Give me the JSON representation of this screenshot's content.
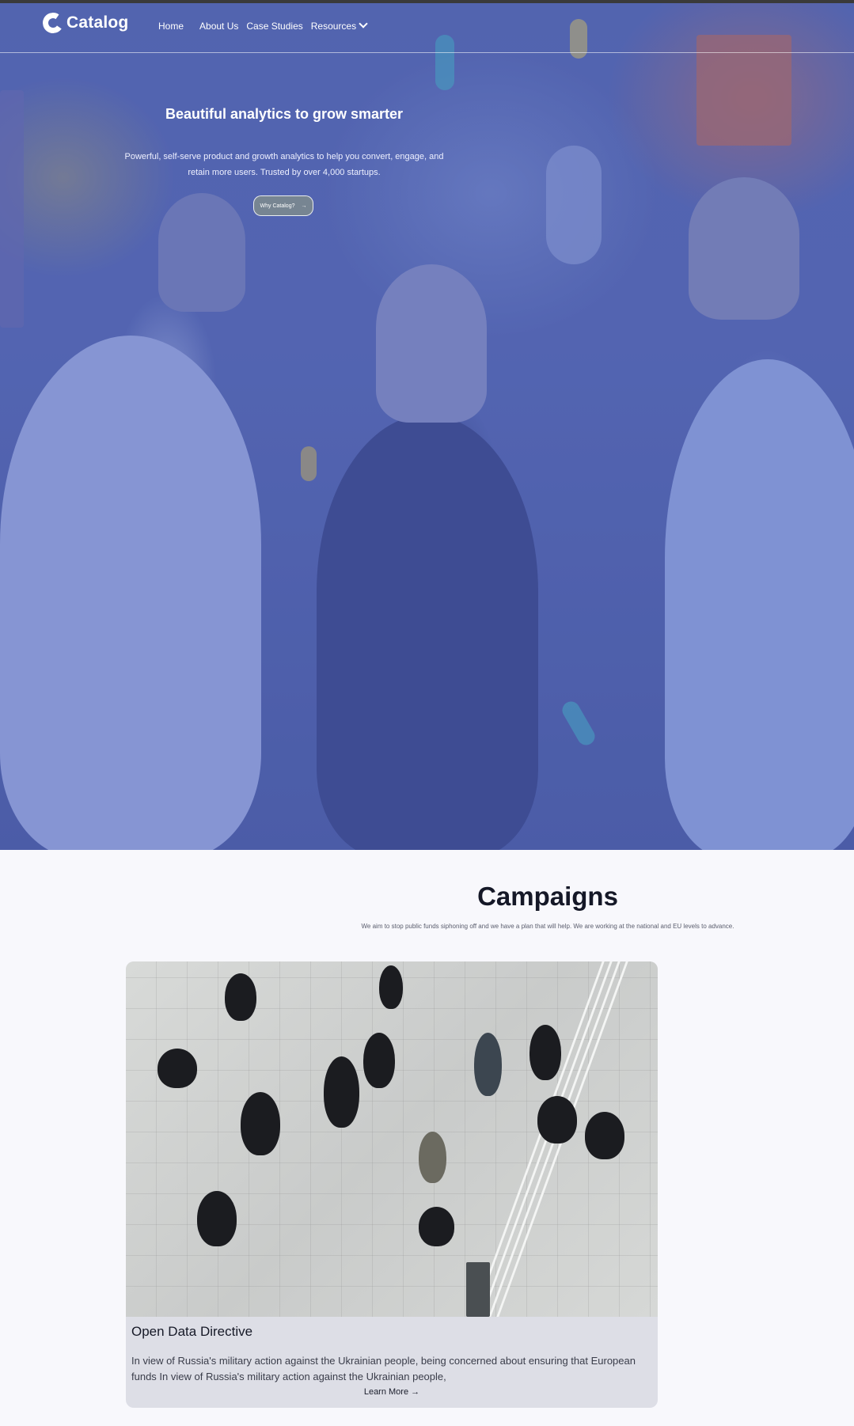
{
  "nav": {
    "brand": "Catalog",
    "links": [
      "Home",
      "About Us",
      "Case Studies",
      "Resources"
    ]
  },
  "hero": {
    "title": "Beautiful analytics to grow smarter",
    "subtitle": "Powerful, self-serve product and growth analytics to help you convert, engage, and retain more users. Trusted by over 4,000 startups.",
    "cta_label": "Why Catalog?",
    "cta_icon": "arrow-right-icon"
  },
  "campaigns": {
    "title": "Campaigns",
    "subtitle": "We aim to stop public funds siphoning off and we have a plan that will help. We are working at the national and EU levels to advance.",
    "card": {
      "title": "Open Data Directive",
      "text": "In view of Russia's military action against the Ukrainian people, being concerned about ensuring that European funds In view of Russia's military action against the Ukrainian people,",
      "link_label": "Learn More",
      "link_icon": "arrow-right-icon"
    }
  },
  "colors": {
    "hero_tint": "#5b6bb6",
    "page_bg": "#f8f8fc",
    "card_bg": "#dddee6"
  }
}
